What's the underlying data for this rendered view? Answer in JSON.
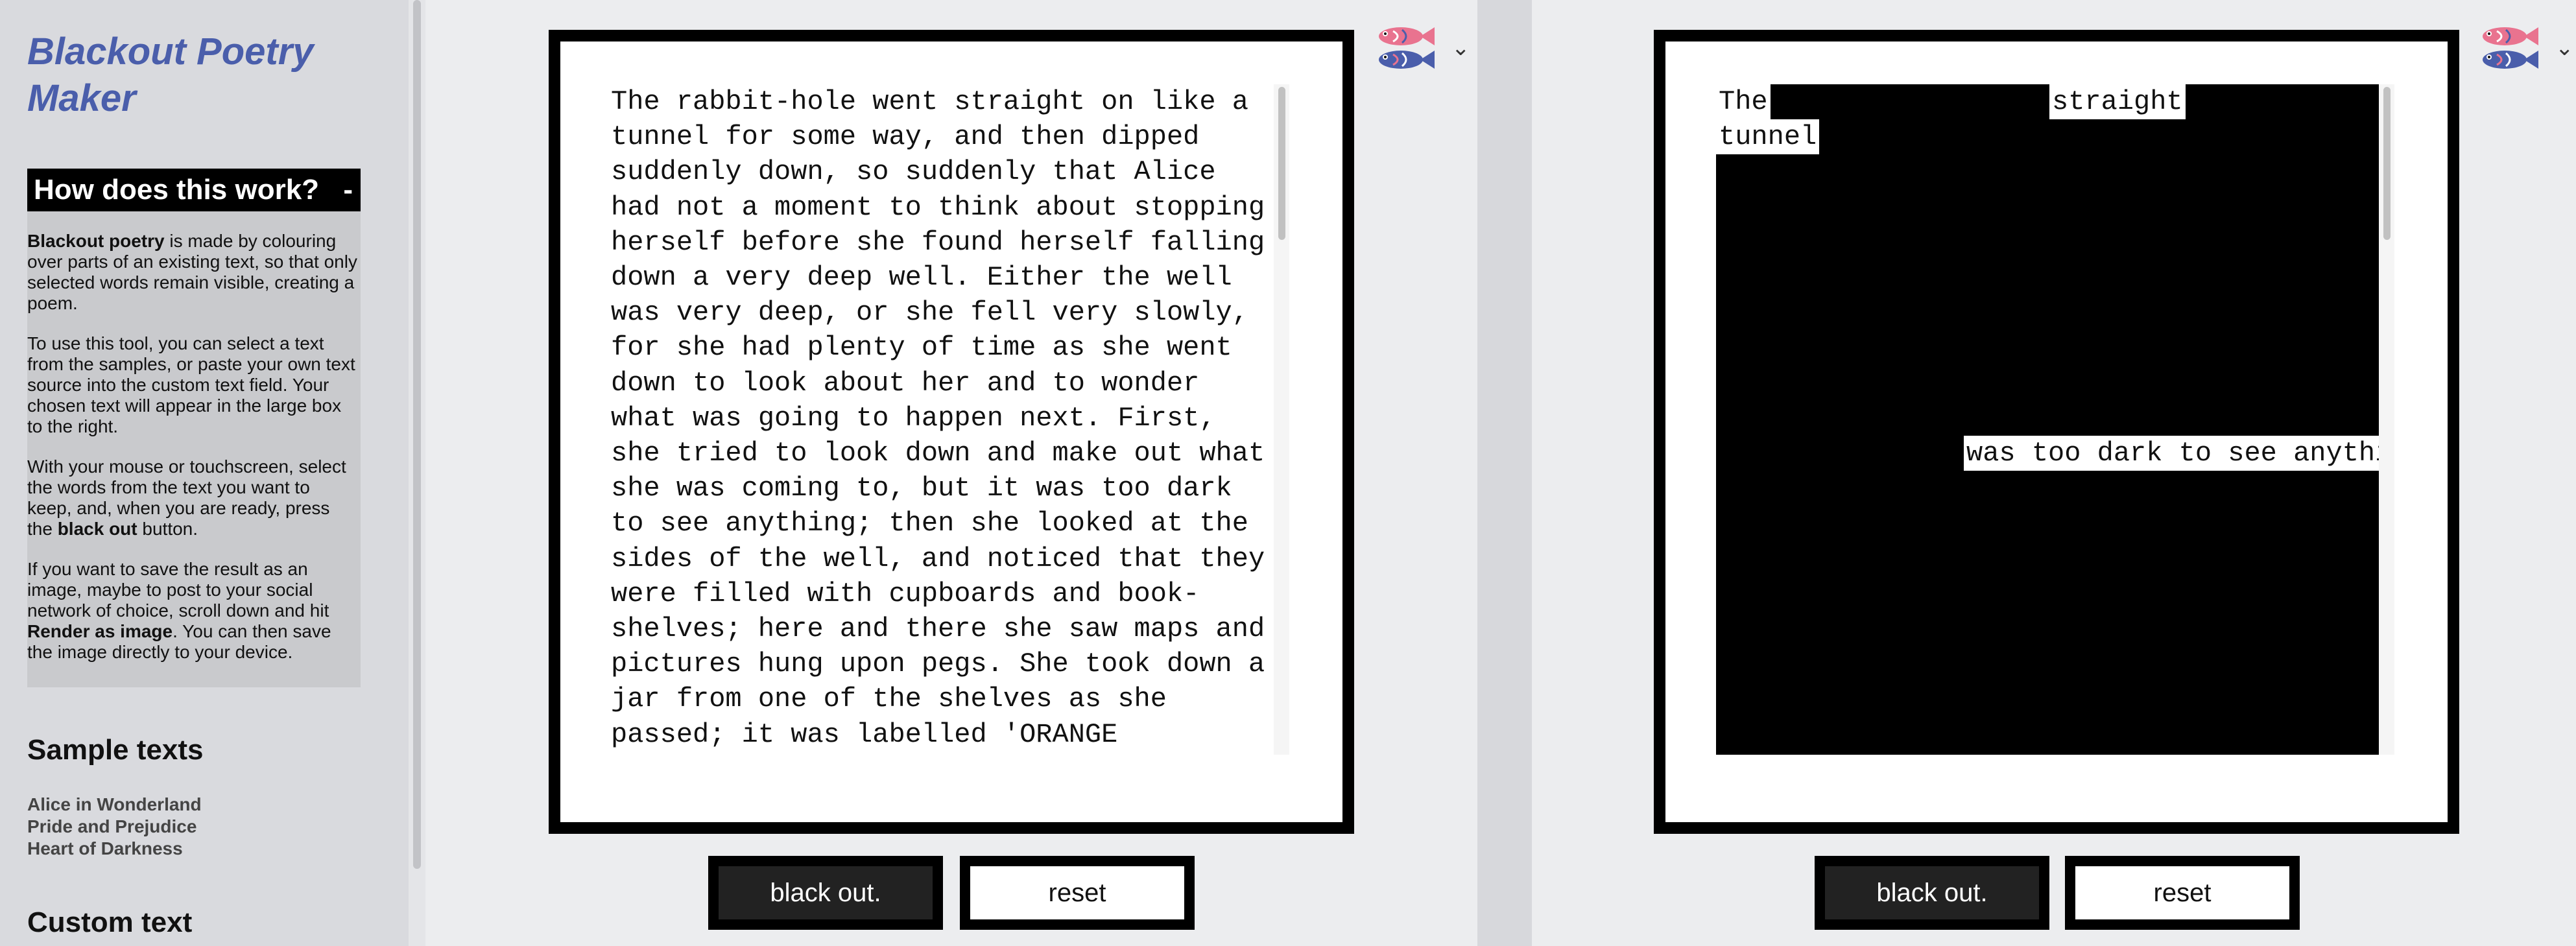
{
  "sidebar": {
    "title": "Blackout Poetry Maker",
    "how": {
      "heading": "How does this work?",
      "toggle": "-",
      "p1_bold": "Blackout poetry",
      "p1_rest": " is made by colouring over parts of an existing text, so that only selected words remain visible, creating a poem.",
      "p2": "To use this tool, you can select a text from the samples, or paste your own text source into the custom text field. Your chosen text will appear in the large box to the right.",
      "p3_a": "With your mouse or touchscreen, select the words from the text you want to keep, and, when you are ready, press the ",
      "p3_bold": "black out",
      "p3_b": " button.",
      "p4_a": "If you want to save the result as an image, maybe to post to your social network of choice, scroll down and hit ",
      "p4_bold": "Render as image",
      "p4_b": ". You can then save the image directly to your device."
    },
    "samples_heading": "Sample texts",
    "samples": [
      "Alice in Wonderland",
      "Pride and Prejudice",
      "Heart of Darkness"
    ],
    "custom_heading": "Custom text"
  },
  "left_panel": {
    "text": "The rabbit-hole went straight on like a tunnel for some way, and then dipped suddenly down, so suddenly that Alice had not a moment to think about stopping herself before she found herself falling down a very deep well. Either the well was very deep, or she fell very slowly, for she had plenty of time as she went down to look about her and to wonder what was going to happen next. First, she tried to look down and make out what she was coming to, but it was too dark to see anything; then she looked at the sides of the well, and noticed that they were filled with cupboards and book-shelves; here and there she saw maps and pictures hung upon pegs. She took down a jar from one of the shelves as she passed; it was labelled 'ORANGE MARMALADE', but to her great disappointment it was empty: she did not like to drop the jar for fear of killing somebody underneath, so managed to put it into one of the cupboards as she fell past it.",
    "blackout_label": "black out.",
    "reset_label": "reset"
  },
  "right_panel": {
    "kept_words": [
      "The",
      "straight",
      "tunnel",
      "was too dark to see anything;"
    ],
    "blackout_label": "black out.",
    "reset_label": "reset"
  },
  "icons": {
    "language": "fish-flag-icon",
    "dropdown": "chevron-down-icon"
  },
  "colors": {
    "title": "#4a5eab",
    "fish_top": "#e9738f",
    "fish_bottom": "#4a5eab"
  }
}
